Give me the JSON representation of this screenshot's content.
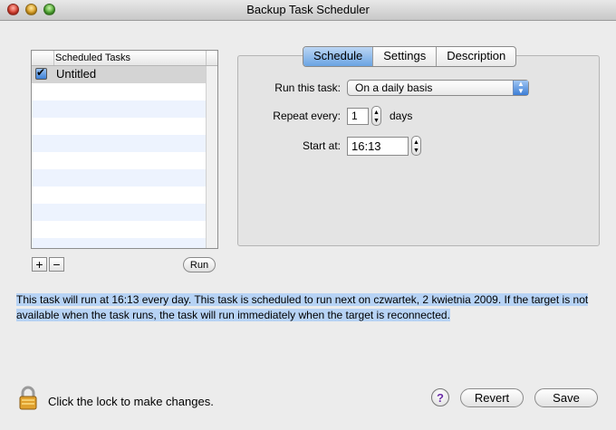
{
  "window": {
    "title": "Backup Task Scheduler"
  },
  "task_list": {
    "column_header": "Scheduled Tasks",
    "tasks": [
      {
        "name": "Untitled",
        "enabled": true
      }
    ]
  },
  "buttons": {
    "add": "+",
    "remove": "−",
    "run": "Run",
    "revert": "Revert",
    "save": "Save",
    "help": "?"
  },
  "tabs": [
    {
      "label": "Schedule",
      "active": true
    },
    {
      "label": "Settings",
      "active": false
    },
    {
      "label": "Description",
      "active": false
    }
  ],
  "schedule": {
    "run_label": "Run this task:",
    "run_value": "On a daily basis",
    "repeat_label": "Repeat every:",
    "repeat_value": "1",
    "repeat_unit": "days",
    "start_label": "Start at:",
    "start_value": "16:13"
  },
  "info_text": "This task will run at 16:13 every day. This task is scheduled to run next on czwartek, 2 kwietnia 2009. If the target is not available when the task runs, the task will run immediately when the target is reconnected.",
  "lock_text": "Click the lock to make changes."
}
